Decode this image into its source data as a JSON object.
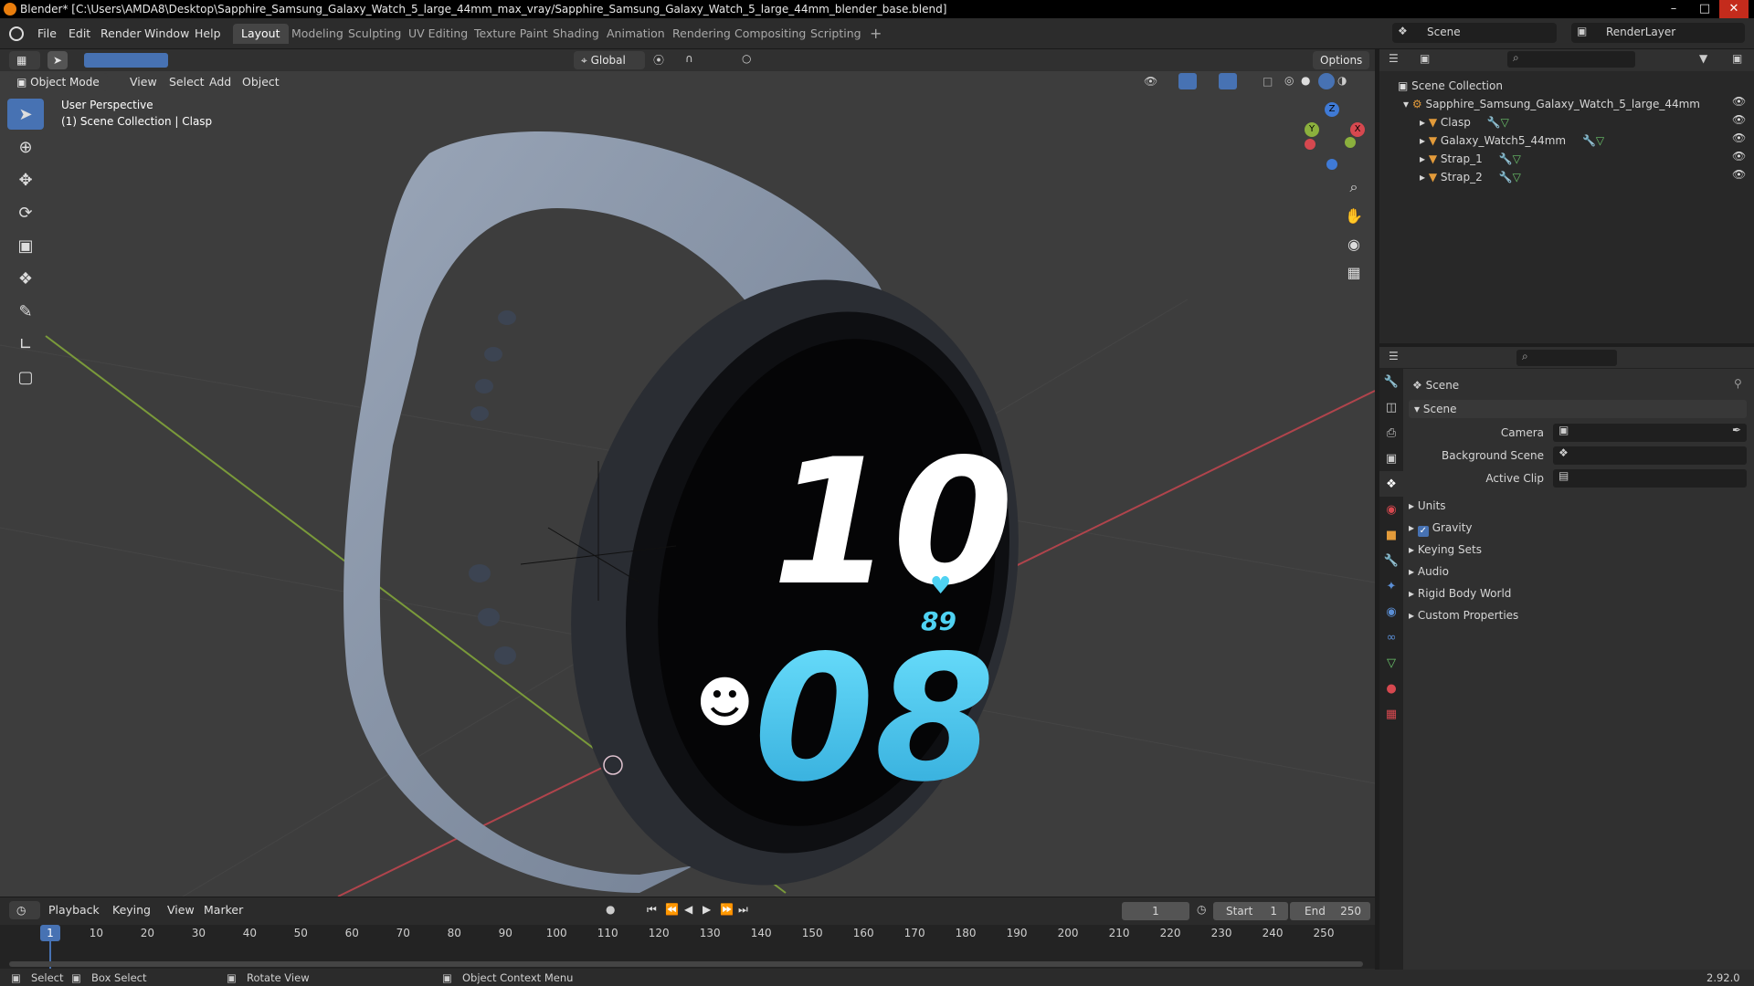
{
  "window": {
    "title": "Blender* [C:\\Users\\AMDA8\\Desktop\\Sapphire_Samsung_Galaxy_Watch_5_large_44mm_max_vray/Sapphire_Samsung_Galaxy_Watch_5_large_44mm_blender_base.blend]"
  },
  "menu": [
    "File",
    "Edit",
    "Render",
    "Window",
    "Help"
  ],
  "workspaces": [
    "Layout",
    "Modeling",
    "Sculpting",
    "UV Editing",
    "Texture Paint",
    "Shading",
    "Animation",
    "Rendering",
    "Compositing",
    "Scripting"
  ],
  "active_workspace": "Layout",
  "top_right": {
    "scene_label": "Scene",
    "render_layer_label": "RenderLayer"
  },
  "viewport_header": {
    "mode": "Object Mode",
    "menus": [
      "View",
      "Select",
      "Add",
      "Object"
    ],
    "transform_orientation": "Global",
    "options_label": "Options"
  },
  "viewport": {
    "perspective_label": "User Perspective",
    "collection_label": "(1) Scene Collection | Clasp",
    "watch_face": {
      "hour": "10",
      "minute": "08",
      "heart_rate": "89"
    }
  },
  "outliner": {
    "root": "Scene Collection",
    "collection": "Sapphire_Samsung_Galaxy_Watch_5_large_44mm",
    "objects": [
      {
        "name": "Clasp"
      },
      {
        "name": "Galaxy_Watch5_44mm"
      },
      {
        "name": "Strap_1"
      },
      {
        "name": "Strap_2"
      }
    ]
  },
  "properties": {
    "context_title": "Scene",
    "panel_title": "Scene",
    "fields": [
      {
        "label": "Camera",
        "value": ""
      },
      {
        "label": "Background Scene",
        "value": ""
      },
      {
        "label": "Active Clip",
        "value": ""
      }
    ],
    "sections": [
      "Units",
      "Gravity",
      "Keying Sets",
      "Audio",
      "Rigid Body World",
      "Custom Properties"
    ],
    "gravity_checked": true
  },
  "timeline": {
    "menus": [
      "Playback",
      "Keying",
      "View",
      "Marker"
    ],
    "current_frame": "1",
    "start_label": "Start",
    "start": "1",
    "end_label": "End",
    "end": "250",
    "ticks": [
      "1",
      "10",
      "20",
      "30",
      "40",
      "50",
      "60",
      "70",
      "80",
      "90",
      "100",
      "110",
      "120",
      "130",
      "140",
      "150",
      "160",
      "170",
      "180",
      "190",
      "200",
      "210",
      "220",
      "230",
      "240",
      "250"
    ]
  },
  "statusbar": {
    "select": "Select",
    "box_select": "Box Select",
    "rotate_view": "Rotate View",
    "context_menu": "Object Context Menu",
    "version": "2.92.0"
  },
  "colors": {
    "accent": "#4772b3",
    "x_axis": "#d6484f",
    "y_axis": "#8bb03d",
    "z_axis": "#3f7ad6",
    "strap": "#8a97ab",
    "cyan_digits": "#4fd2f2"
  }
}
